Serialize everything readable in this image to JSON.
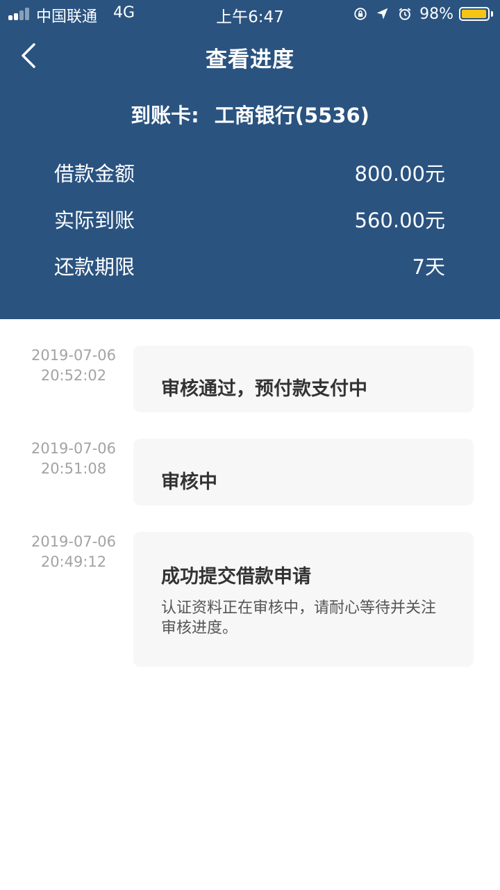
{
  "status_bar": {
    "carrier": "中国联通",
    "network": "4G",
    "time": "上午6:47",
    "battery_pct": "98%",
    "battery_level": 0.98,
    "battery_color": "#f6c513",
    "icons": [
      "orientation-lock-icon",
      "location-arrow-icon",
      "alarm-icon"
    ]
  },
  "nav": {
    "back_icon": "chevron-left-icon",
    "title": "查看进度"
  },
  "card": {
    "label": "到账卡:",
    "bank": "工商银行(5536)"
  },
  "details": [
    {
      "label": "借款金额",
      "value": "800.00元"
    },
    {
      "label": "实际到账",
      "value": "560.00元"
    },
    {
      "label": "还款期限",
      "value": "7天"
    }
  ],
  "timeline": [
    {
      "date": "2019-07-06",
      "time": "20:52:02",
      "title": "审核通过，预付款支付中",
      "desc": ""
    },
    {
      "date": "2019-07-06",
      "time": "20:51:08",
      "title": "审核中",
      "desc": ""
    },
    {
      "date": "2019-07-06",
      "time": "20:49:12",
      "title": "成功提交借款申请",
      "desc": "认证资料正在审核中，请耐心等待并关注审核进度。"
    }
  ],
  "colors": {
    "header_bg": "#2a5380",
    "card_bg": "#f7f7f7",
    "time_text": "#a3a3a3",
    "title_text": "#333333"
  }
}
